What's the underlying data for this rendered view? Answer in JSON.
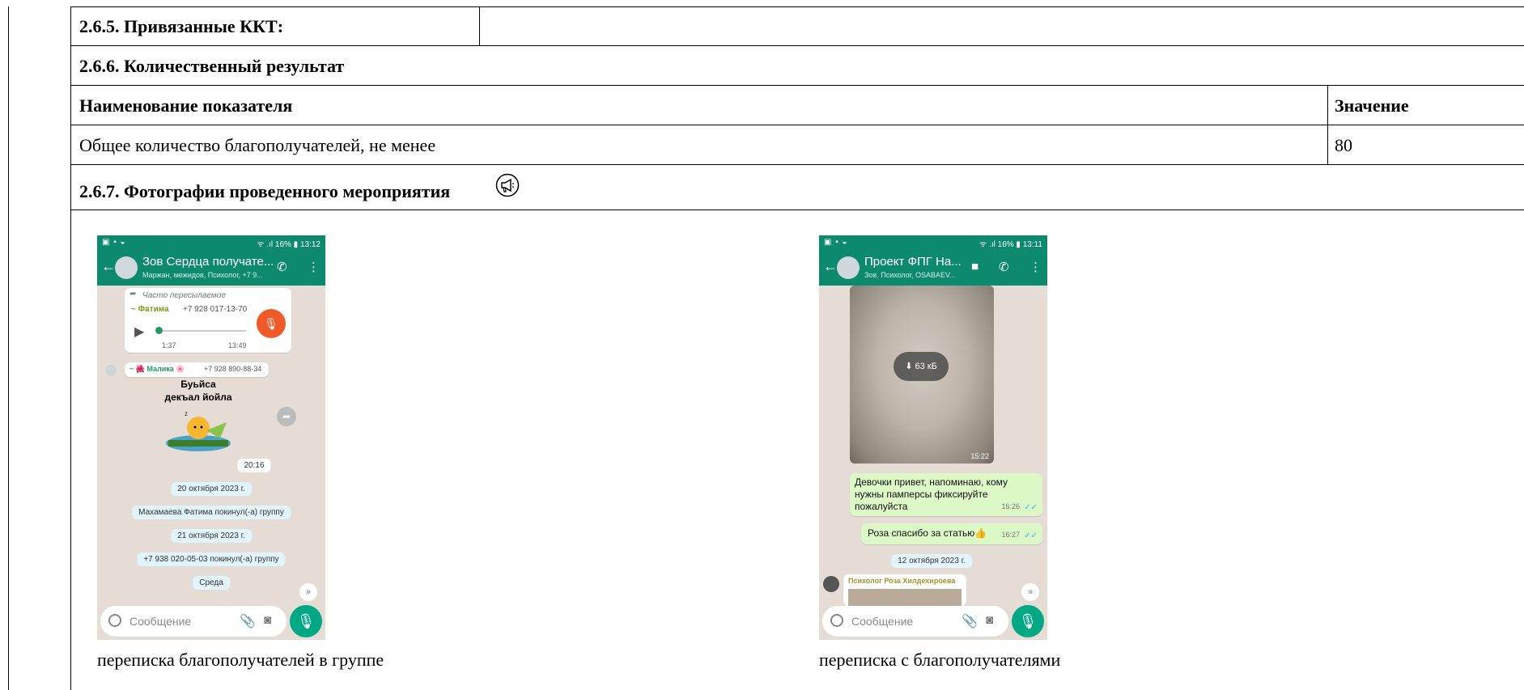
{
  "table": {
    "row_kkt_label": "2.6.5. Привязанные ККТ:",
    "row_quant_label": "2.6.6. Количественный результат",
    "col_indicator": "Наименование показателя",
    "col_value": "Значение",
    "indicator_name": "Общее количество благополучателей, не менее",
    "indicator_value": "80",
    "photos_label": "2.6.7. Фотографии проведенного мероприятия"
  },
  "icons": {
    "megaphone": "megaphone-icon"
  },
  "photos": [
    {
      "caption": "переписка благополучателей в группе",
      "status_time": "ᯤ .ıl 16% ▮ 13:12",
      "chat_title": "Зов Сердца получате...",
      "chat_subtitle": "Маржан, межидов, Психолог, +7 9...",
      "forwarded": "Часто пересылаемое",
      "sender1": "~ Фатима",
      "sender1_phone": "+7 928 017-13-70",
      "audio_pos": "1:37",
      "audio_time": "13:49",
      "sender2": "~ 🌺 Малика 🌸",
      "sender2_phone": "+7 928 890-88-34",
      "sticker_text_1": "Буьйса",
      "sticker_text_2": "декъал йойла",
      "sticker_time": "20:16",
      "date1": "20 октября 2023 г.",
      "event1": "Махамаева Фатима покинул(-а) группу",
      "date2": "21 октября 2023 г.",
      "event2": "+7 938 020-05-03 покинул(-а) группу",
      "date3": "Среда",
      "input_placeholder": "Сообщение"
    },
    {
      "caption": "переписка с благополучателями",
      "status_time": "ᯤ .ıl 16% ▮ 13:11",
      "chat_title": "Проект ФПГ На...",
      "chat_subtitle": "Зов, Психолог, OSABAEV...",
      "media_size": "63 кБ",
      "media_time": "15:22",
      "msg1": "Девочки привет, напоминаю, кому нужны памперсы фиксируйте пожалуйста",
      "msg1_time": "16:26",
      "msg2": "Роза спасибо за статью👍",
      "msg2_time": "16:27",
      "date1": "12 октября 2023 г.",
      "sender": "Психолог Роза Хилдехироева",
      "input_placeholder": "Сообщение"
    }
  ],
  "colors": {
    "whatsapp_header": "#0d8a6e",
    "outgoing": "#dcf8c6",
    "mic": "#00a884"
  }
}
